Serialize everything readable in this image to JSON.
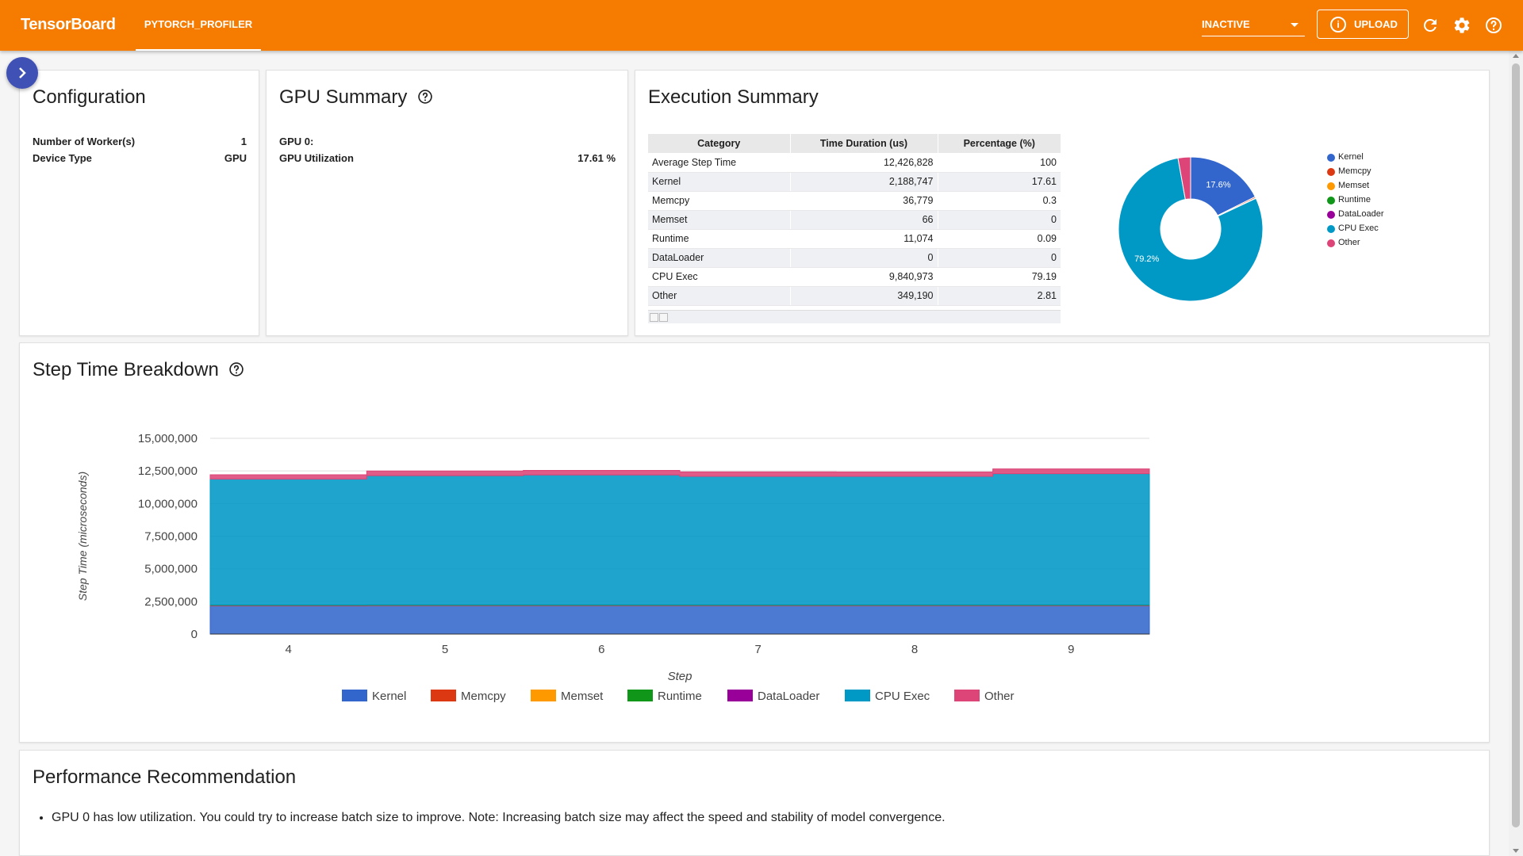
{
  "app": {
    "brand": "TensorBoard",
    "active_tab": "PYTORCH_PROFILER",
    "run_status": "INACTIVE",
    "upload_label": "UPLOAD",
    "icons": [
      "refresh-icon",
      "settings-icon",
      "help-icon"
    ],
    "accent_color": "#f57c00"
  },
  "configuration": {
    "title": "Configuration",
    "rows": [
      {
        "label": "Number of Worker(s)",
        "value": "1"
      },
      {
        "label": "Device Type",
        "value": "GPU"
      }
    ]
  },
  "gpu_summary": {
    "title": "GPU Summary",
    "gpu_label": "GPU 0:",
    "utilization_label": "GPU Utilization",
    "utilization_value": "17.61 %"
  },
  "execution_summary": {
    "title": "Execution Summary",
    "columns": [
      "Category",
      "Time Duration (us)",
      "Percentage (%)"
    ],
    "rows": [
      {
        "category": "Average Step Time",
        "duration": "12,426,828",
        "percentage": "100"
      },
      {
        "category": "Kernel",
        "duration": "2,188,747",
        "percentage": "17.61"
      },
      {
        "category": "Memcpy",
        "duration": "36,779",
        "percentage": "0.3"
      },
      {
        "category": "Memset",
        "duration": "66",
        "percentage": "0"
      },
      {
        "category": "Runtime",
        "duration": "11,074",
        "percentage": "0.09"
      },
      {
        "category": "DataLoader",
        "duration": "0",
        "percentage": "0"
      },
      {
        "category": "CPU Exec",
        "duration": "9,840,973",
        "percentage": "79.19"
      },
      {
        "category": "Other",
        "duration": "349,190",
        "percentage": "2.81"
      }
    ],
    "pie_labels": [
      "17.6%",
      "79.2%"
    ],
    "legend": [
      {
        "name": "Kernel",
        "color": "#3366cc"
      },
      {
        "name": "Memcpy",
        "color": "#dc3912"
      },
      {
        "name": "Memset",
        "color": "#ff9900"
      },
      {
        "name": "Runtime",
        "color": "#109618"
      },
      {
        "name": "DataLoader",
        "color": "#990099"
      },
      {
        "name": "CPU Exec",
        "color": "#0099c6"
      },
      {
        "name": "Other",
        "color": "#dd4477"
      }
    ]
  },
  "step_time": {
    "title": "Step Time Breakdown"
  },
  "chart_data": [
    {
      "type": "pie",
      "title": "",
      "categories": [
        "Kernel",
        "Memcpy",
        "Memset",
        "Runtime",
        "DataLoader",
        "CPU Exec",
        "Other"
      ],
      "values": [
        17.61,
        0.3,
        0,
        0.09,
        0,
        79.19,
        2.81
      ],
      "colors": [
        "#3366cc",
        "#dc3912",
        "#ff9900",
        "#109618",
        "#990099",
        "#0099c6",
        "#dd4477"
      ],
      "donut": true,
      "legend": "right"
    },
    {
      "type": "area",
      "title": "",
      "stacked": true,
      "xlabel": "Step",
      "ylabel": "Step Time (microseconds)",
      "x": [
        4,
        5,
        6,
        7,
        8,
        9
      ],
      "ylim": [
        0,
        15000000
      ],
      "yticks": [
        "0",
        "2,500,000",
        "5,000,000",
        "7,500,000",
        "10,000,000",
        "12,500,000",
        "15,000,000"
      ],
      "series": [
        {
          "name": "Kernel",
          "color": "#3366cc",
          "values": [
            2180000,
            2190000,
            2190000,
            2190000,
            2190000,
            2190000
          ]
        },
        {
          "name": "Memcpy",
          "color": "#dc3912",
          "values": [
            37000,
            37000,
            37000,
            37000,
            37000,
            37000
          ]
        },
        {
          "name": "Memset",
          "color": "#ff9900",
          "values": [
            0,
            0,
            0,
            0,
            0,
            0
          ]
        },
        {
          "name": "Runtime",
          "color": "#109618",
          "values": [
            11000,
            11000,
            11000,
            11000,
            11000,
            11000
          ]
        },
        {
          "name": "DataLoader",
          "color": "#990099",
          "values": [
            0,
            0,
            0,
            0,
            0,
            0
          ]
        },
        {
          "name": "CPU Exec",
          "color": "#0099c6",
          "values": [
            9650000,
            9900000,
            9950000,
            9850000,
            9850000,
            10050000
          ]
        },
        {
          "name": "Other",
          "color": "#dd4477",
          "values": [
            330000,
            360000,
            350000,
            340000,
            330000,
            370000
          ]
        }
      ],
      "legend": "bottom",
      "grid": true
    }
  ],
  "recommendation": {
    "title": "Performance Recommendation",
    "items": [
      "GPU 0 has low utilization. You could try to increase batch size to improve. Note: Increasing batch size may affect the speed and stability of model convergence."
    ]
  }
}
